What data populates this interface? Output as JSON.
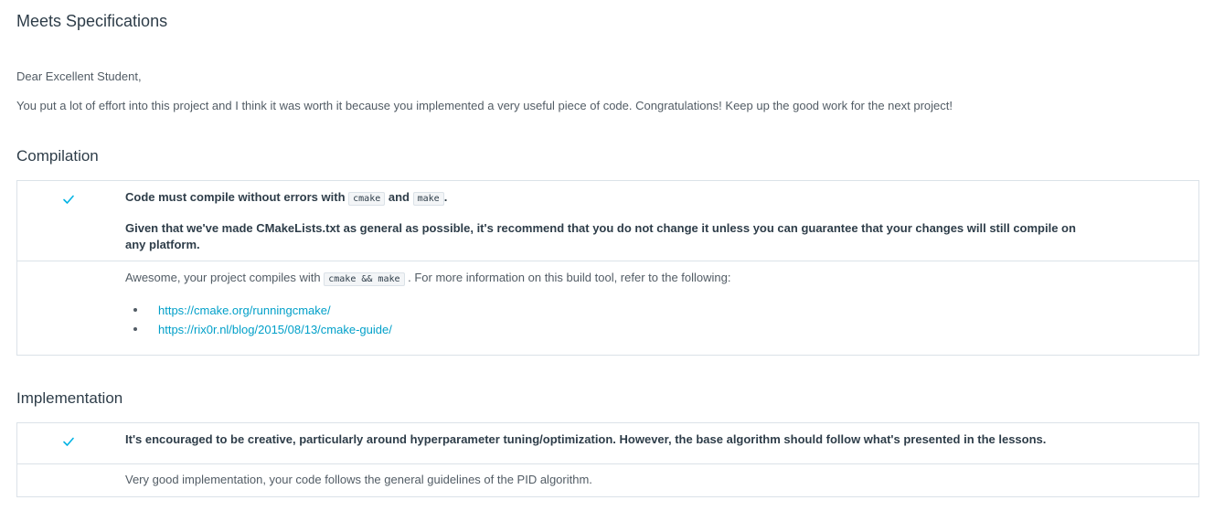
{
  "header": {
    "title": "Meets Specifications"
  },
  "intro": {
    "greeting": "Dear Excellent Student,",
    "message": "You put a lot of effort into this project and I think it was worth it because you implemented a very useful piece of code. Congratulations! Keep up the good work for the next project!"
  },
  "sections": [
    {
      "title": "Compilation",
      "status_icon": "check-icon",
      "criteria": {
        "line1_before": "Code must compile without errors with ",
        "code1": "cmake",
        "line1_mid": " and ",
        "code2": "make",
        "line1_after": ".",
        "line2": "Given that we've made CMakeLists.txt as general as possible, it's recommend that you do not change it unless you can guarantee that your changes will still compile on any platform."
      },
      "review": {
        "before": "Awesome, your project compiles with ",
        "code": "cmake && make",
        "after": " . For more information on this build tool, refer to the following:",
        "links": [
          "https://cmake.org/runningcmake/",
          "https://rix0r.nl/blog/2015/08/13/cmake-guide/"
        ]
      }
    },
    {
      "title": "Implementation",
      "status_icon": "check-icon",
      "criteria": {
        "text": "It's encouraged to be creative, particularly around hyperparameter tuning/optimization. However, the base algorithm should follow what's presented in the lessons."
      },
      "review": {
        "text": "Very good implementation, your code follows the general guidelines of the PID algorithm."
      }
    }
  ],
  "colors": {
    "check": "#02b3e4",
    "link": "#02a0c9",
    "border": "#dbe2e8"
  }
}
